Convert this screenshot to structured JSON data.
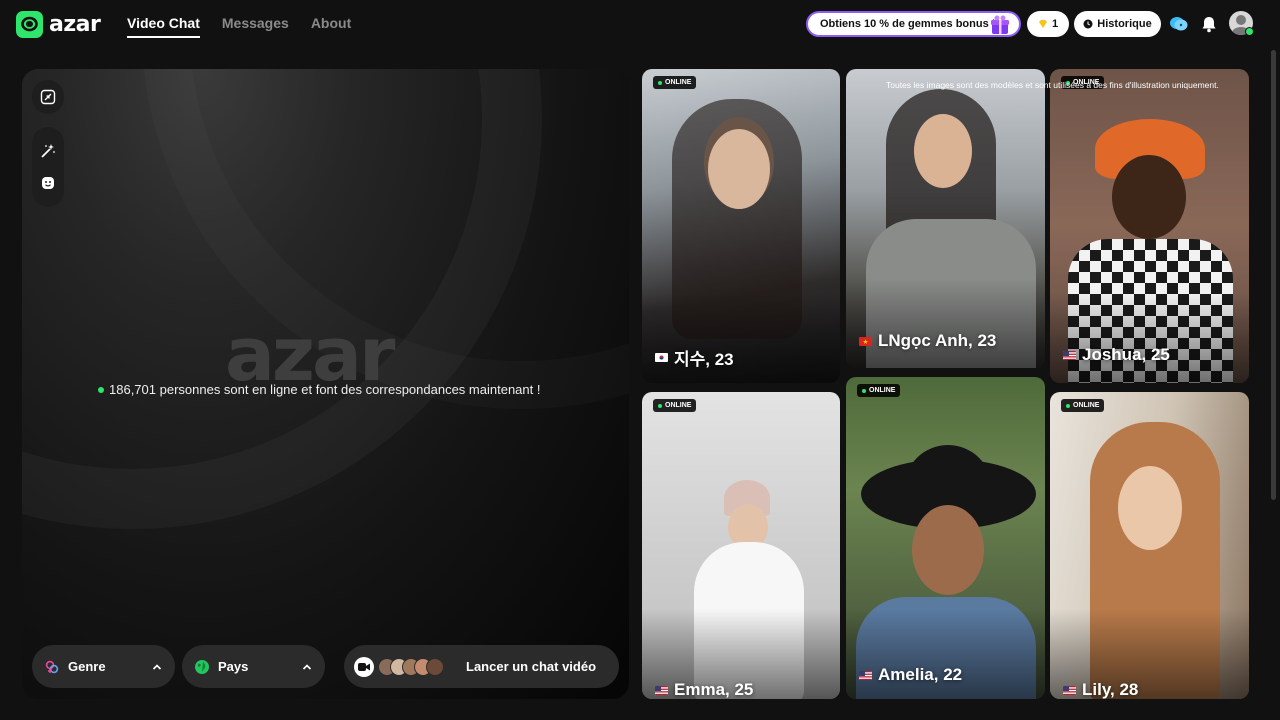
{
  "app": {
    "logo_text": "azar",
    "big_logo_text": "azar"
  },
  "nav": {
    "items": [
      {
        "label": "Video Chat",
        "active": true
      },
      {
        "label": "Messages",
        "active": false
      },
      {
        "label": "About",
        "active": false
      }
    ]
  },
  "header": {
    "promo_label": "Obtiens 10 % de gemmes bonus !",
    "gems_count": "1",
    "history_label": "Historique",
    "avatar_badge": "1"
  },
  "main": {
    "online_text": "186,701 personnes sont en ligne et font des correspondances maintenant !",
    "gender_filter": "Genre",
    "country_filter": "Pays",
    "launch_label": "Lancer un chat vidéo"
  },
  "gallery": {
    "disclaimer": "Toutes les images sont des modèles et sont utilisées à des fins d'illustration uniquement.",
    "online_badge": "ONLINE",
    "cards": [
      {
        "name": "지수, 23",
        "flag": "South Korea",
        "online": true
      },
      {
        "name": "LNgọc Anh, 23",
        "flag": "Vietnam",
        "online": false
      },
      {
        "name": "Joshua, 25",
        "flag": "United States",
        "online": true
      },
      {
        "name": "Emma, 25",
        "flag": "United States",
        "online": true
      },
      {
        "name": "Amelia, 22",
        "flag": "United States",
        "online": true
      },
      {
        "name": "Lily, 28",
        "flag": "United States",
        "online": true
      }
    ]
  },
  "colors": {
    "accent_green": "#2ee66b",
    "promo_border": "#8b5cf6"
  }
}
